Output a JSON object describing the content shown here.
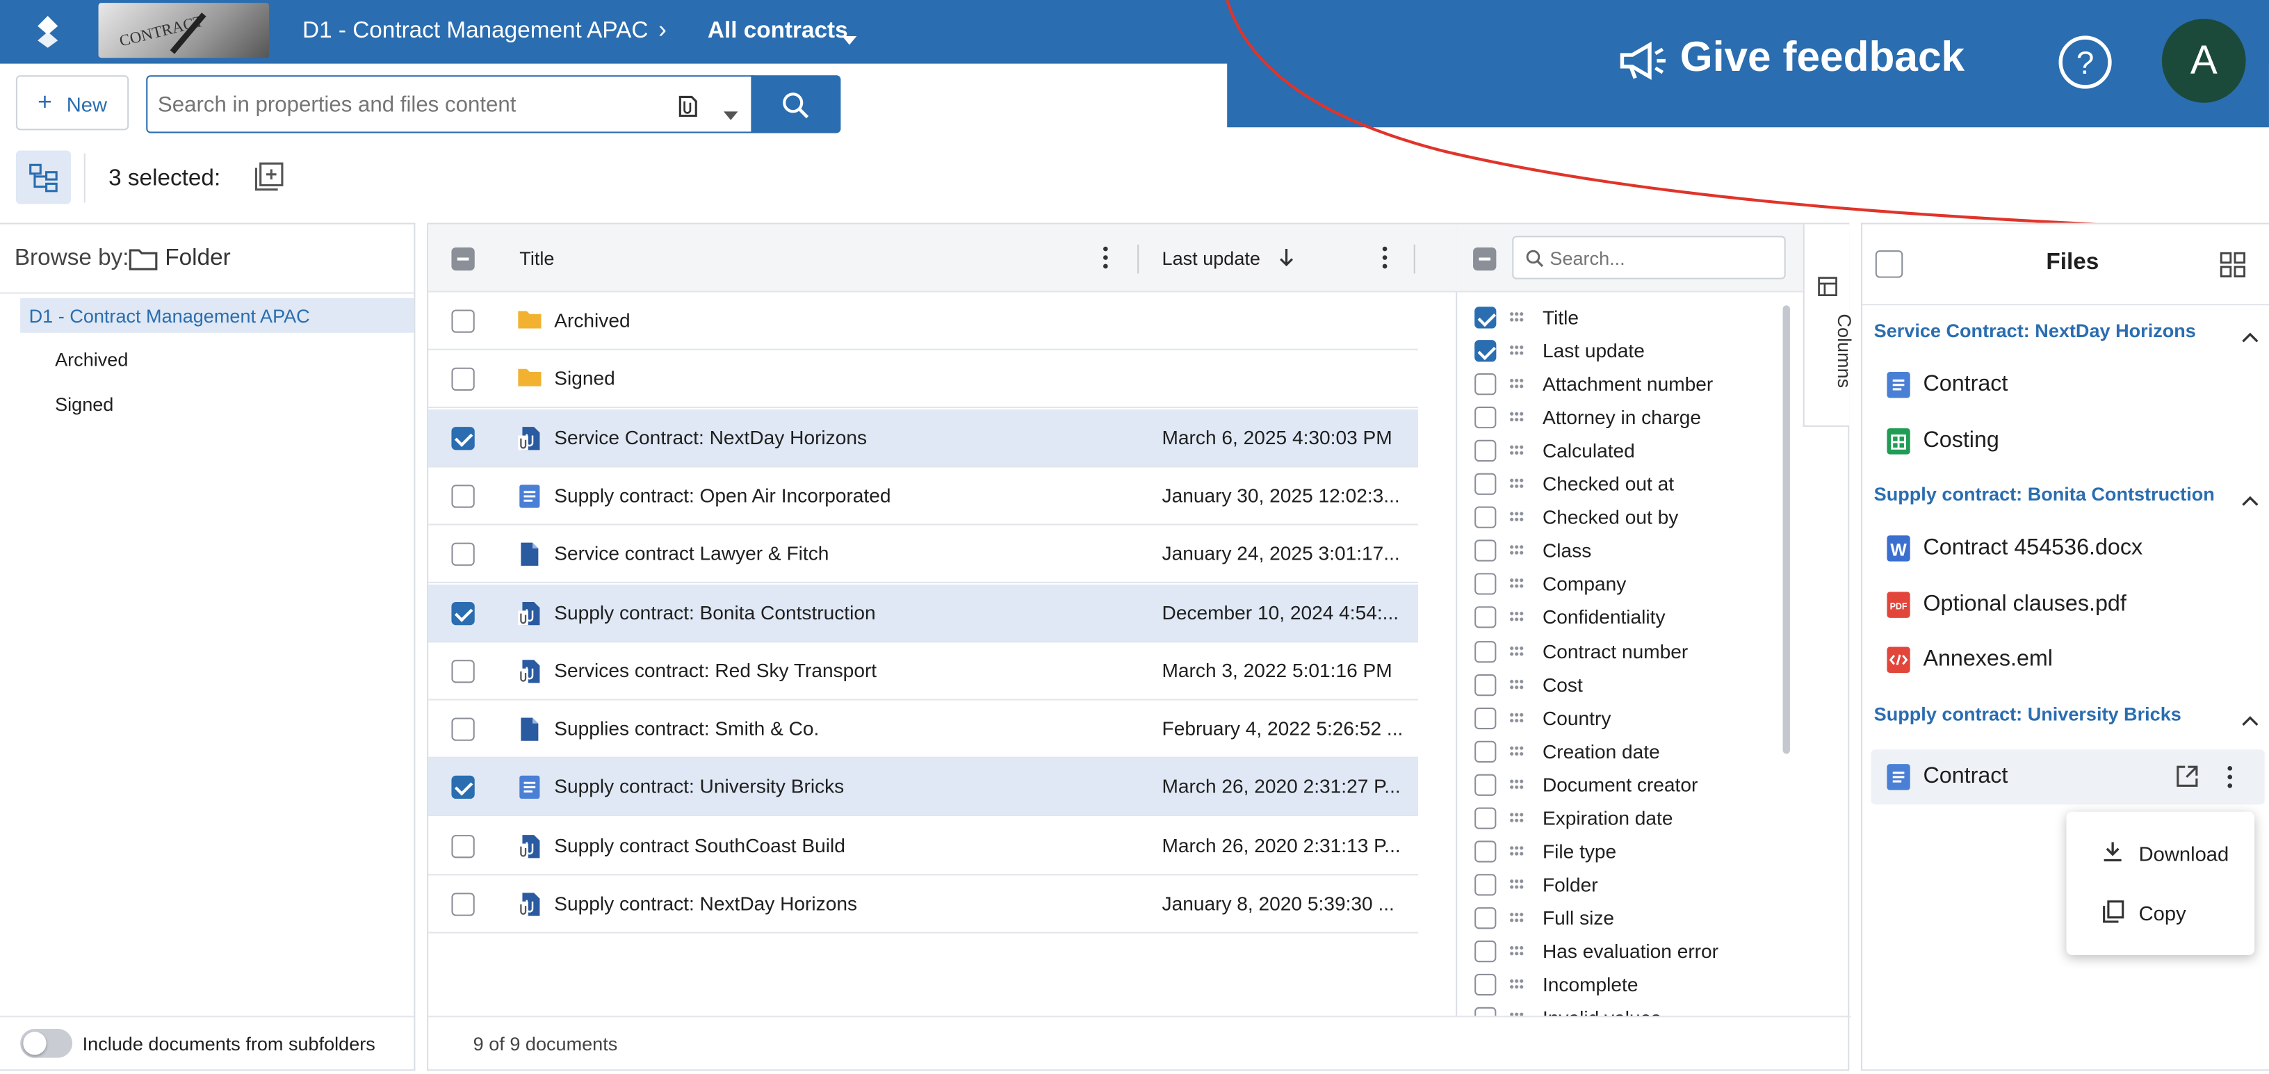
{
  "header": {
    "breadcrumb_root": "D1 - Contract Management APAC",
    "breadcrumb_current": "All contracts",
    "feedback": "Give feedback",
    "help_icon": "help-icon",
    "avatar_letter": "A",
    "logo_icon": "layers-logo-icon",
    "thumbnail_text": "CONTRACT"
  },
  "toolbar": {
    "new_label": "New",
    "search_placeholder": "Search in properties and files content",
    "selected_count": "3 selected:"
  },
  "browse": {
    "label": "Browse by:",
    "mode": "Folder",
    "tree": {
      "root": "D1 - Contract Management APAC",
      "children": [
        "Archived",
        "Signed"
      ]
    },
    "subfolders_label": "Include documents from subfolders"
  },
  "grid": {
    "col_title": "Title",
    "col_last_update": "Last update",
    "footer": "9 of 9 documents",
    "rows": [
      {
        "title": "Archived",
        "date": "",
        "checked": false,
        "icon": "folder"
      },
      {
        "title": "Signed",
        "date": "",
        "checked": false,
        "icon": "folder"
      },
      {
        "title": "Service Contract: NextDay Horizons",
        "date": "March 6, 2025 4:30:03 PM",
        "checked": true,
        "icon": "attachment-doc"
      },
      {
        "title": "Supply contract: Open Air Incorporated",
        "date": "January 30, 2025 12:02:3...",
        "checked": false,
        "icon": "text-doc"
      },
      {
        "title": "Service contract Lawyer & Fitch",
        "date": "January 24, 2025 3:01:17...",
        "checked": false,
        "icon": "doc"
      },
      {
        "title": "Supply contract: Bonita Contstruction",
        "date": "December 10, 2024 4:54:...",
        "checked": true,
        "icon": "attachment-doc"
      },
      {
        "title": "Services contract: Red Sky Transport",
        "date": "March 3, 2022 5:01:16 PM",
        "checked": false,
        "icon": "attachment-doc"
      },
      {
        "title": "Supplies contract: Smith & Co.",
        "date": "February 4, 2022 5:26:52 ...",
        "checked": false,
        "icon": "doc"
      },
      {
        "title": "Supply contract: University Bricks",
        "date": "March 26, 2020 2:31:27 P...",
        "checked": true,
        "icon": "text-doc"
      },
      {
        "title": "Supply contract SouthCoast Build",
        "date": "March 26, 2020 2:31:13 P...",
        "checked": false,
        "icon": "attachment-doc"
      },
      {
        "title": "Supply contract: NextDay Horizons",
        "date": "January 8, 2020 5:39:30 ...",
        "checked": false,
        "icon": "attachment-doc"
      }
    ]
  },
  "columns": {
    "search_placeholder": "Search...",
    "tab_label": "Columns",
    "items": [
      {
        "label": "Title",
        "checked": true
      },
      {
        "label": "Last update",
        "checked": true
      },
      {
        "label": "Attachment number",
        "checked": false
      },
      {
        "label": "Attorney in charge",
        "checked": false
      },
      {
        "label": "Calculated",
        "checked": false
      },
      {
        "label": "Checked out at",
        "checked": false
      },
      {
        "label": "Checked out by",
        "checked": false
      },
      {
        "label": "Class",
        "checked": false
      },
      {
        "label": "Company",
        "checked": false
      },
      {
        "label": "Confidentiality",
        "checked": false
      },
      {
        "label": "Contract number",
        "checked": false
      },
      {
        "label": "Cost",
        "checked": false
      },
      {
        "label": "Country",
        "checked": false
      },
      {
        "label": "Creation date",
        "checked": false
      },
      {
        "label": "Document creator",
        "checked": false
      },
      {
        "label": "Expiration date",
        "checked": false
      },
      {
        "label": "File type",
        "checked": false
      },
      {
        "label": "Folder",
        "checked": false
      },
      {
        "label": "Full size",
        "checked": false
      },
      {
        "label": "Has evaluation error",
        "checked": false
      },
      {
        "label": "Incomplete",
        "checked": false
      },
      {
        "label": "Invalid values",
        "checked": false
      }
    ]
  },
  "files": {
    "title": "Files",
    "groups": [
      {
        "title": "Service Contract: NextDay Horizons",
        "files": [
          {
            "name": "Contract",
            "icon": "gdoc"
          },
          {
            "name": "Costing",
            "icon": "gsheet"
          }
        ]
      },
      {
        "title": "Supply contract: Bonita Contstruction",
        "files": [
          {
            "name": "Contract 454536.docx",
            "icon": "word"
          },
          {
            "name": "Optional clauses.pdf",
            "icon": "pdf"
          },
          {
            "name": "Annexes.eml",
            "icon": "eml"
          }
        ]
      },
      {
        "title": "Supply contract: University Bricks",
        "files": [
          {
            "name": "Contract",
            "icon": "gdoc"
          }
        ]
      }
    ],
    "menu": {
      "download": "Download",
      "copy": "Copy"
    }
  },
  "colors": {
    "primary": "#2a6db0",
    "selected_row": "#dfe8f4",
    "avatar": "#1b4a3a",
    "annotation": "#e0342a"
  }
}
